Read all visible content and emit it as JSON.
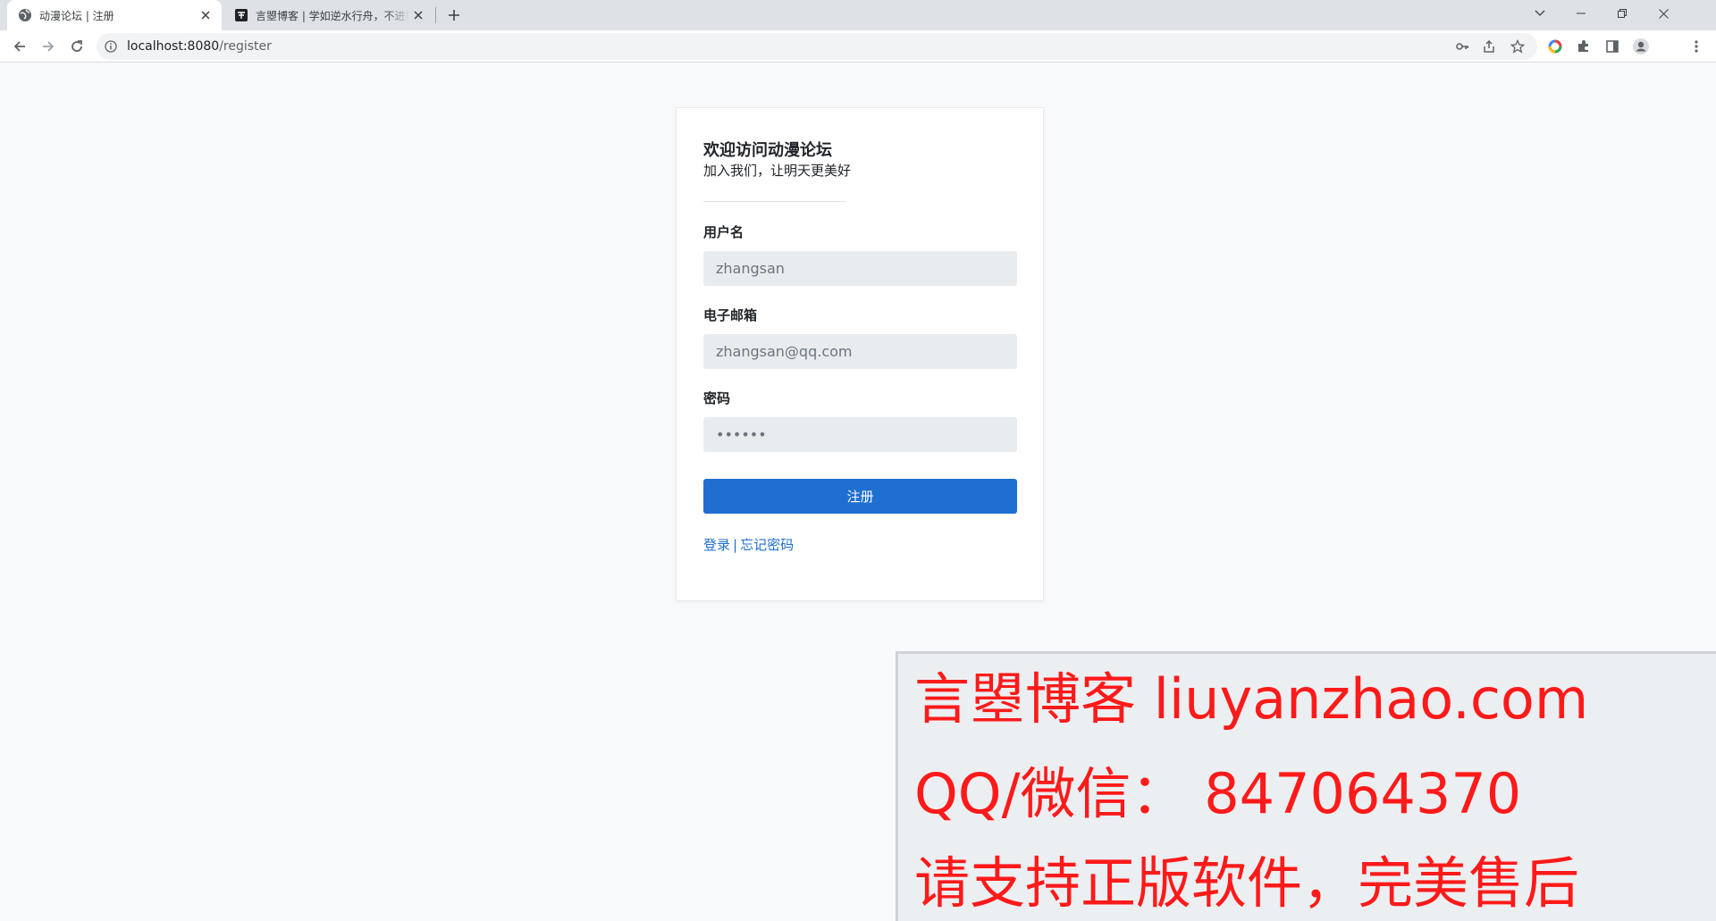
{
  "browser": {
    "tabs": [
      {
        "title": "动漫论坛 | 注册",
        "active": true,
        "icon": "globe-icon"
      },
      {
        "title": "言曌博客 | 学如逆水行舟，不进则退",
        "active": false,
        "icon": "blog-favicon-icon"
      }
    ],
    "address": {
      "host": "localhost:8080",
      "path": "/register"
    }
  },
  "page": {
    "heading": "欢迎访问动漫论坛",
    "subheading": "加入我们，让明天更美好",
    "form": {
      "username_label": "用户名",
      "username_placeholder": "zhangsan",
      "email_label": "电子邮箱",
      "email_placeholder": "zhangsan@qq.com",
      "password_label": "密码",
      "password_placeholder": "••••••",
      "submit_label": "注册"
    },
    "links": {
      "login": "登录",
      "separator": "|",
      "forgot": "忘记密码"
    }
  },
  "watermark": {
    "line1": "言曌博客 liuyanzhao.com",
    "line2": "QQ/微信：  847064370",
    "line3": "请支持正版软件，完美售后",
    "color": "#ff1a1a"
  },
  "colors": {
    "primary": "#1f6fd1",
    "page_background": "#f8f9fa",
    "input_background": "#e9ecef"
  }
}
